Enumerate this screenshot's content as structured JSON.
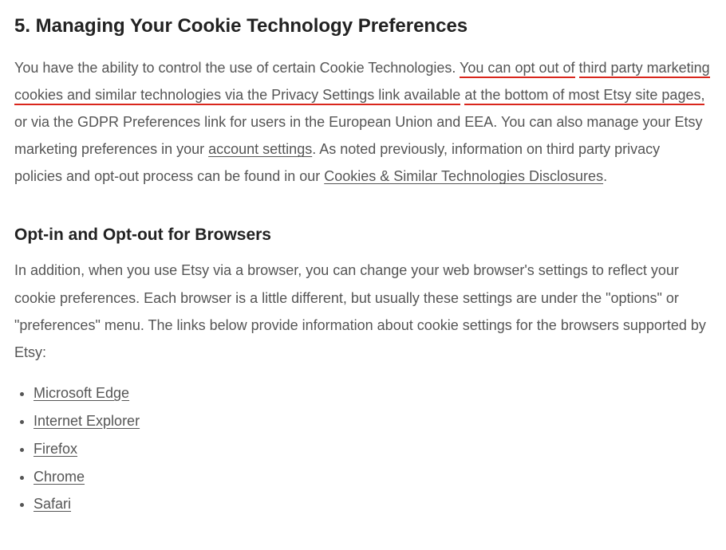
{
  "section": {
    "heading": "5. Managing Your Cookie Technology Preferences",
    "paragraph1": {
      "t1": "You have the ability to control the use of certain Cookie Technologies. ",
      "hl1": "You can opt out of",
      "sp1": " ",
      "hl2": "third party marketing cookies and similar technologies via the Privacy Settings link available",
      "sp2": " ",
      "hl3": "at the bottom of most Etsy site pages,",
      "t2": " or via the GDPR Preferences link for users in the European Union and EEA. You can also manage your Etsy marketing preferences in your ",
      "link1": "account settings",
      "t3": ". As noted previously, information on third party privacy policies and opt-out process can be found in our ",
      "link2": "Cookies & Similar Technologies Disclosures",
      "t4": "."
    },
    "subheading": "Opt-in and Opt-out for Browsers",
    "paragraph2": "In addition, when you use Etsy via a browser, you can change your web browser's settings to reflect your cookie preferences. Each browser is a little different, but usually these settings are under the \"options\" or \"preferences\" menu. The links below provide information about cookie settings for the browsers supported by Etsy:",
    "browsers": {
      "b0": "Microsoft Edge",
      "b1": "Internet Explorer",
      "b2": "Firefox",
      "b3": "Chrome",
      "b4": "Safari"
    }
  }
}
